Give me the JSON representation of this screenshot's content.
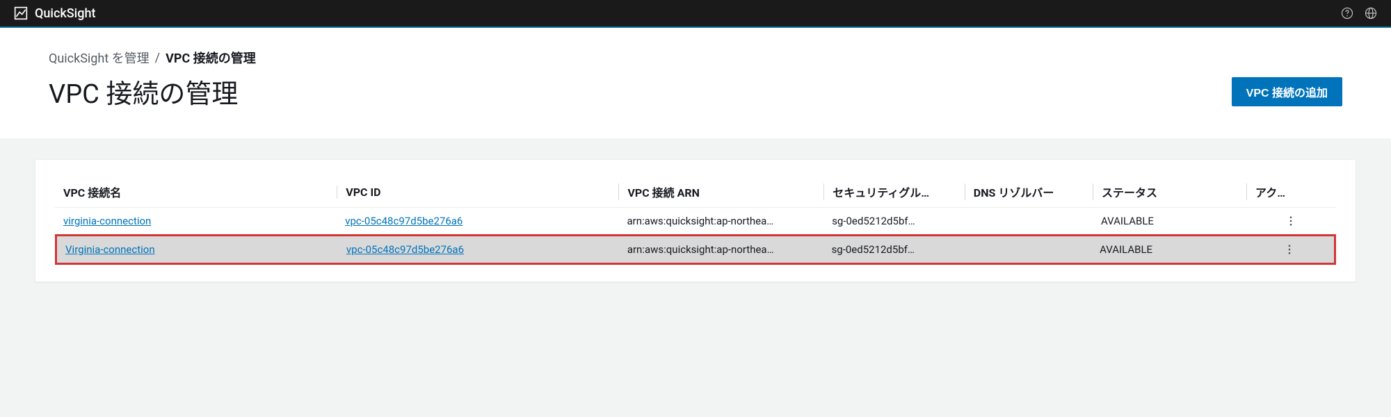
{
  "brand": "QuickSight",
  "topbar": {
    "help_icon": "help-icon",
    "globe_icon": "globe-icon"
  },
  "breadcrumb": {
    "root": "QuickSight を管理",
    "sep": "/",
    "current": "VPC 接続の管理"
  },
  "page_title": "VPC 接続の管理",
  "add_button": "VPC 接続の追加",
  "table": {
    "headers": {
      "name": "VPC 接続名",
      "vpcid": "VPC ID",
      "arn": "VPC 接続 ARN",
      "sg": "セキュリティグル…",
      "dns": "DNS リゾルバー",
      "status": "ステータス",
      "action": "アク…"
    },
    "rows": [
      {
        "name": "virginia-connection",
        "vpcid": "vpc-05c48c97d5be276a6",
        "arn": "arn:aws:quicksight:ap-northea…",
        "sg": "sg-0ed5212d5bf…",
        "dns": "",
        "status": "AVAILABLE",
        "highlighted": false
      },
      {
        "name": "Virginia-connection",
        "vpcid": "vpc-05c48c97d5be276a6",
        "arn": "arn:aws:quicksight:ap-northea…",
        "sg": "sg-0ed5212d5bf…",
        "dns": "",
        "status": "AVAILABLE",
        "highlighted": true
      }
    ]
  }
}
